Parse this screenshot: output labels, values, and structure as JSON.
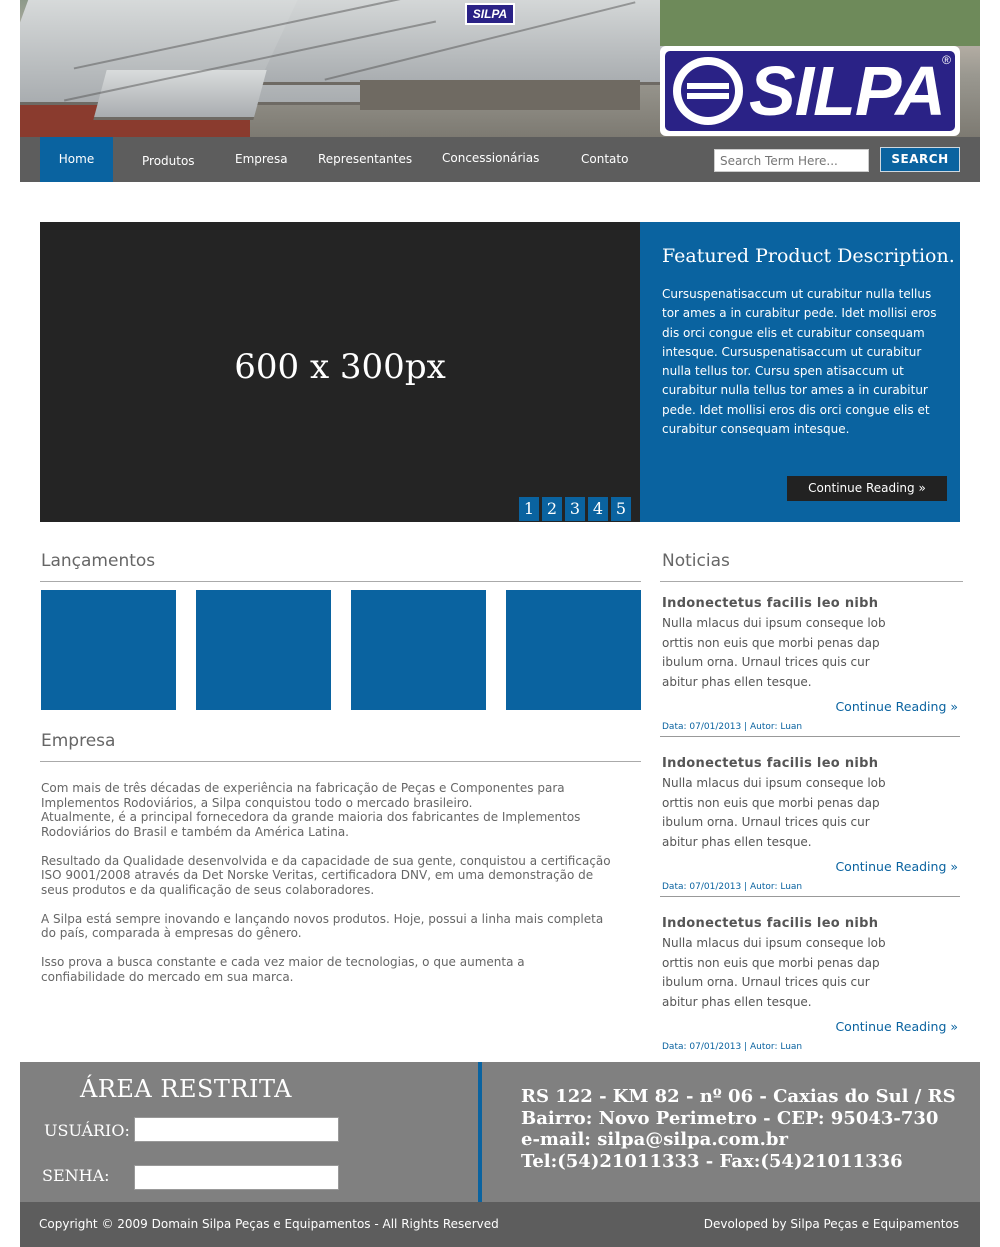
{
  "header": {
    "logo_text": "SILPA",
    "logo_reg": "®"
  },
  "nav": {
    "items": [
      "Home",
      "Produtos",
      "Empresa",
      "Representantes",
      "Concessionárias",
      "Contato"
    ],
    "search_placeholder": "Search Term Here...",
    "search_button": "SEARCH"
  },
  "featured": {
    "image_placeholder": "600 x 300px",
    "pages": [
      "1",
      "2",
      "3",
      "4",
      "5"
    ],
    "title": "Featured Product Description.",
    "body": "Cursuspenatisaccum ut curabitur nulla tellus tor ames a in curabitur pede. Idet mollisi eros dis orci congue elis et curabitur consequam intesque. Cursuspenatisaccum ut curabitur nulla tellus tor. Cursu spen atisaccum ut curabitur nulla tellus tor ames a in curabitur pede. Idet mollisi eros dis orci congue elis et curabitur consequam intesque.",
    "button": "Continue Reading »"
  },
  "lancamentos": {
    "title": "Lançamentos"
  },
  "empresa": {
    "title": "Empresa",
    "paragraphs": [
      "Com mais de três décadas de experiência na fabricação de Peças e Componentes para\nImplementos Rodoviários, a Silpa conquistou todo o mercado brasileiro.\nAtualmente, é a principal fornecedora da grande maioria dos fabricantes de Implementos\nRodoviários do Brasil e também da América Latina.",
      "Resultado da Qualidade desenvolvida e da capacidade de sua gente, conquistou a certificação\nISO 9001/2008 através da Det Norske Veritas, certificadora DNV, em uma demonstração de\nseus produtos e da qualificação de seus colaboradores.",
      "A Silpa está sempre inovando e lançando novos produtos. Hoje, possui a linha mais completa\ndo país, comparada à empresas do gênero.",
      "Isso prova a busca constante e cada vez maior de tecnologias, o que aumenta a\nconfiabilidade do mercado em sua marca."
    ]
  },
  "noticias": {
    "title": "Noticias",
    "items": [
      {
        "title": "Indonectetus facilis leo nibh",
        "body": "Nulla mlacus dui ipsum conseque lob orttis non euis que morbi penas dap ibulum orna. Urnaul trices quis cur abitur phas ellen tesque.",
        "more": "Continue Reading »",
        "meta": "Data: 07/01/2013 | Autor: Luan"
      },
      {
        "title": "Indonectetus facilis leo nibh",
        "body": "Nulla mlacus dui ipsum conseque lob orttis non euis que morbi penas dap ibulum orna. Urnaul trices quis cur abitur phas ellen tesque.",
        "more": "Continue Reading »",
        "meta": "Data: 07/01/2013 | Autor: Luan"
      },
      {
        "title": "Indonectetus facilis leo nibh",
        "body": "Nulla mlacus dui ipsum conseque lob orttis non euis que morbi penas dap ibulum orna. Urnaul trices quis cur abitur phas ellen tesque.",
        "more": "Continue Reading »",
        "meta": "Data: 07/01/2013 | Autor: Luan"
      }
    ]
  },
  "footer": {
    "area_title": "ÁREA RESTRITA",
    "user_label": "USUÁRIO:",
    "password_label": "SENHA:",
    "address_lines": [
      "RS 122 - KM 82 - nº 06 - Caxias do Sul / RS",
      "Bairro: Novo Perimetro - CEP: 95043-730",
      "e-mail: silpa@silpa.com.br",
      "Tel:(54)21011333 - Fax:(54)21011336"
    ],
    "copyright": "Copyright © 2009 Domain Silpa Peças e Equipamentos - All Rights Reserved",
    "developed": "Devoloped by Silpa Peças e Equipamentos"
  },
  "colors": {
    "accent": "#0a63a0",
    "nav_bg": "#5d5d5d",
    "footer_bg": "#808080",
    "slider_bg": "#242424",
    "logo_blue": "#2a2286"
  }
}
